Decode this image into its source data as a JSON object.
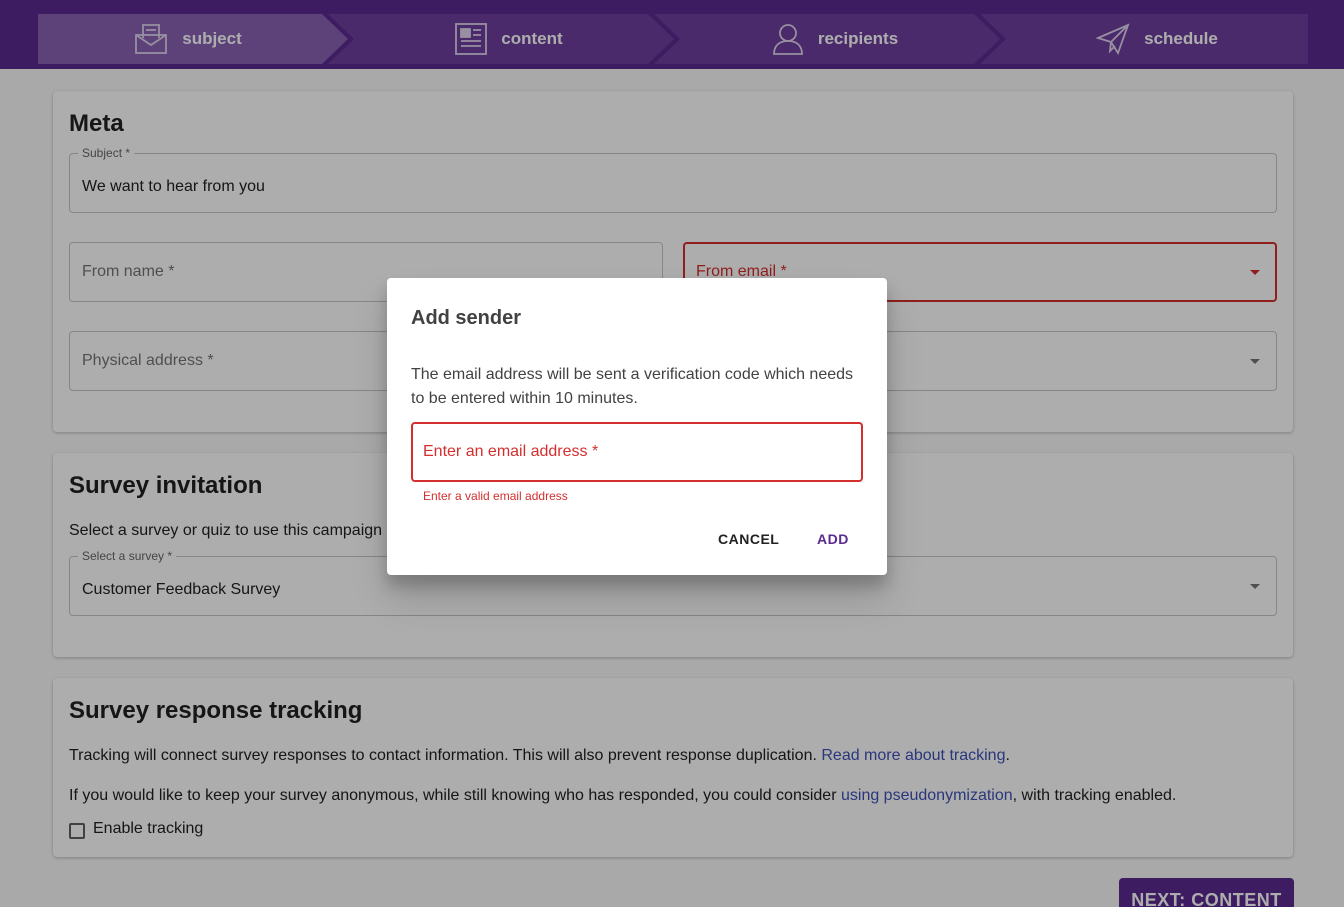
{
  "stepper": {
    "steps": [
      {
        "label": "subject",
        "icon": "mail-envelope-icon",
        "active": true
      },
      {
        "label": "content",
        "icon": "newspaper-icon",
        "active": false
      },
      {
        "label": "recipients",
        "icon": "user-icon",
        "active": false
      },
      {
        "label": "schedule",
        "icon": "paper-plane-icon",
        "active": false
      }
    ]
  },
  "meta": {
    "title": "Meta",
    "subject_label": "Subject *",
    "subject_value": "We want to hear from you",
    "from_name_placeholder": "From name *",
    "from_email_placeholder": "From email *",
    "physical_address_placeholder": "Physical address *"
  },
  "survey_invitation": {
    "title": "Survey invitation",
    "description": "Select a survey or quiz to use this campaign a",
    "select_label": "Select a survey *",
    "select_value": "Customer Feedback Survey"
  },
  "tracking": {
    "title": "Survey response tracking",
    "line1_text": "Tracking will connect survey responses to contact information. This will also prevent response duplication. ",
    "line1_link": "Read more about tracking",
    "line1_end": ".",
    "line2_text": "If you would like to keep your survey anonymous, while still knowing who has responded, you could consider ",
    "line2_link": "using pseudonymization",
    "line2_end": ", with tracking enabled.",
    "checkbox_label": "Enable tracking",
    "checkbox_checked": false
  },
  "next_button_label": "NEXT: CONTENT",
  "dialog": {
    "title": "Add sender",
    "text": "The email address will be sent a verification code which needs to be entered within 10 minutes.",
    "email_placeholder": "Enter an email address *",
    "error_text": "Enter a valid email address",
    "cancel_label": "CANCEL",
    "add_label": "ADD"
  },
  "colors": {
    "brand": "#5b2a8f",
    "error": "#d32f2f",
    "link": "#3f51b5"
  }
}
